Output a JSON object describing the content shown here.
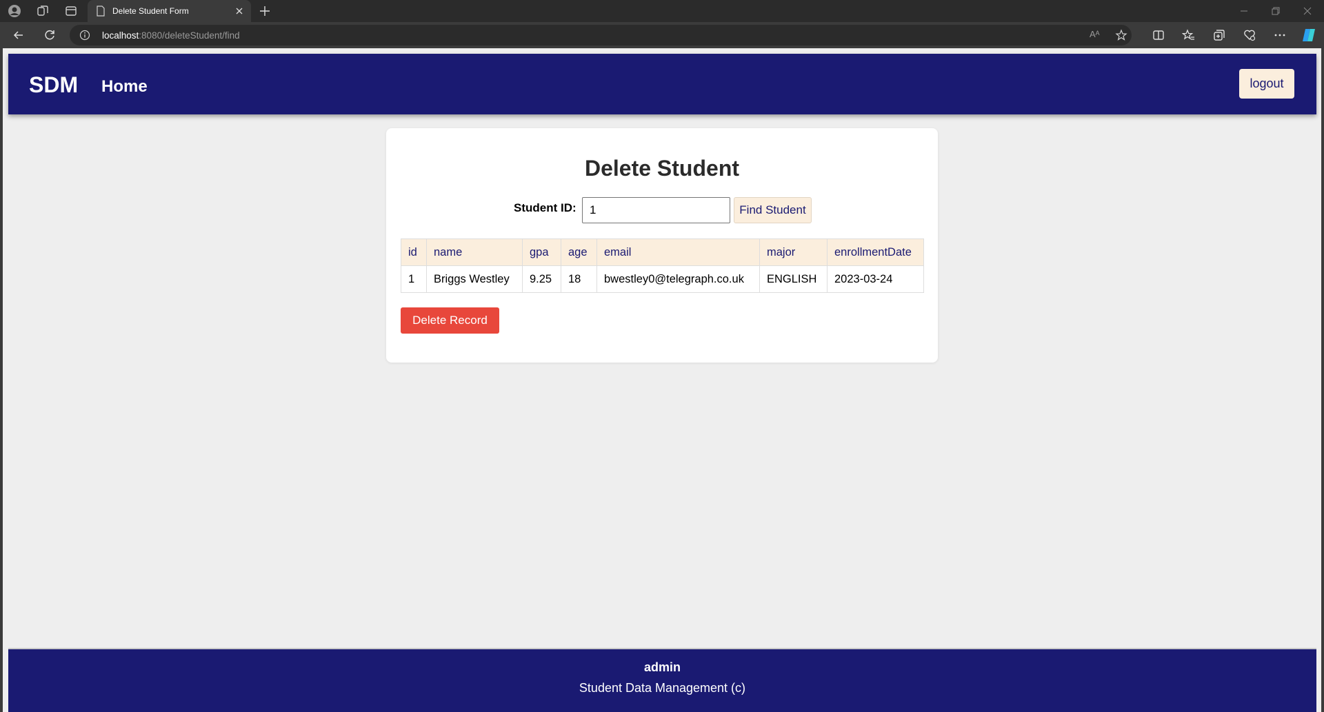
{
  "browser": {
    "tab_title": "Delete Student Form",
    "url_host": "localhost",
    "url_rest": ":8080/deleteStudent/find",
    "read_aloud_label": "Aᴬ"
  },
  "nav": {
    "brand": "SDM",
    "home": "Home",
    "logout": "logout"
  },
  "form": {
    "title": "Delete Student",
    "student_id_label": "Student ID:",
    "student_id_value": "1",
    "find_button": "Find Student"
  },
  "table": {
    "headers": [
      "id",
      "name",
      "gpa",
      "age",
      "email",
      "major",
      "enrollmentDate"
    ],
    "rows": [
      [
        "1",
        "Briggs Westley",
        "9.25",
        "18",
        "bwestley0@telegraph.co.uk",
        "ENGLISH",
        "2023-03-24"
      ]
    ]
  },
  "delete_button": "Delete Record",
  "footer": {
    "user": "admin",
    "copyright": "Student Data Management (c)"
  },
  "colors": {
    "navbar": "#1a1a72",
    "accent_cream": "#fbeedd",
    "danger": "#e8473b",
    "page_bg": "#eeeeee"
  }
}
